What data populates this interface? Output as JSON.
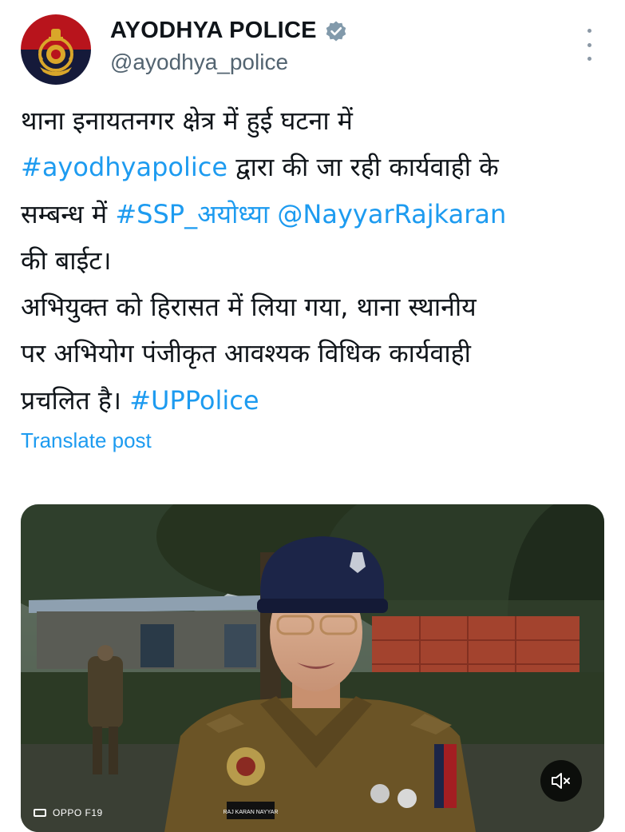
{
  "account": {
    "display_name": "AYODHYA POLICE",
    "handle": "@ayodhya_police",
    "verified": true,
    "avatar_icon": "up-police-emblem-icon"
  },
  "post": {
    "lines": [
      [
        {
          "t": "थाना इनायतनगर क्षेत्र में हुई घटना में",
          "k": "text"
        }
      ],
      [
        {
          "t": "#ayodhyapolice",
          "k": "link"
        },
        {
          "t": " द्वारा की जा रही कार्यवाही के",
          "k": "text"
        }
      ],
      [
        {
          "t": "सम्बन्ध में ",
          "k": "text"
        },
        {
          "t": "#SSP_अयोध्या",
          "k": "link"
        },
        {
          "t": " ",
          "k": "text"
        },
        {
          "t": "@NayyarRajkaran",
          "k": "link"
        }
      ],
      [
        {
          "t": "की बाईट।",
          "k": "text"
        }
      ],
      [
        {
          "t": "अभियुक्त को हिरासत में लिया गया, थाना स्थानीय",
          "k": "text"
        }
      ],
      [
        {
          "t": "पर अभियोग पंजीकृत आवश्यक विधिक कार्यवाही",
          "k": "text"
        }
      ],
      [
        {
          "t": "प्रचलित है। ",
          "k": "text"
        },
        {
          "t": "#UPPolice",
          "k": "link"
        }
      ]
    ],
    "translate_label": "Translate post"
  },
  "media": {
    "type": "video",
    "watermark": "OPPO F19",
    "mute_icon": "speaker-muted-icon",
    "badge_text": "RAJ KARAN NAYYAR"
  },
  "colors": {
    "link": "#1d9bf0",
    "text": "#0f1419",
    "secondary": "#536471",
    "uniform": "#6b5426",
    "cap": "#1c2548"
  }
}
